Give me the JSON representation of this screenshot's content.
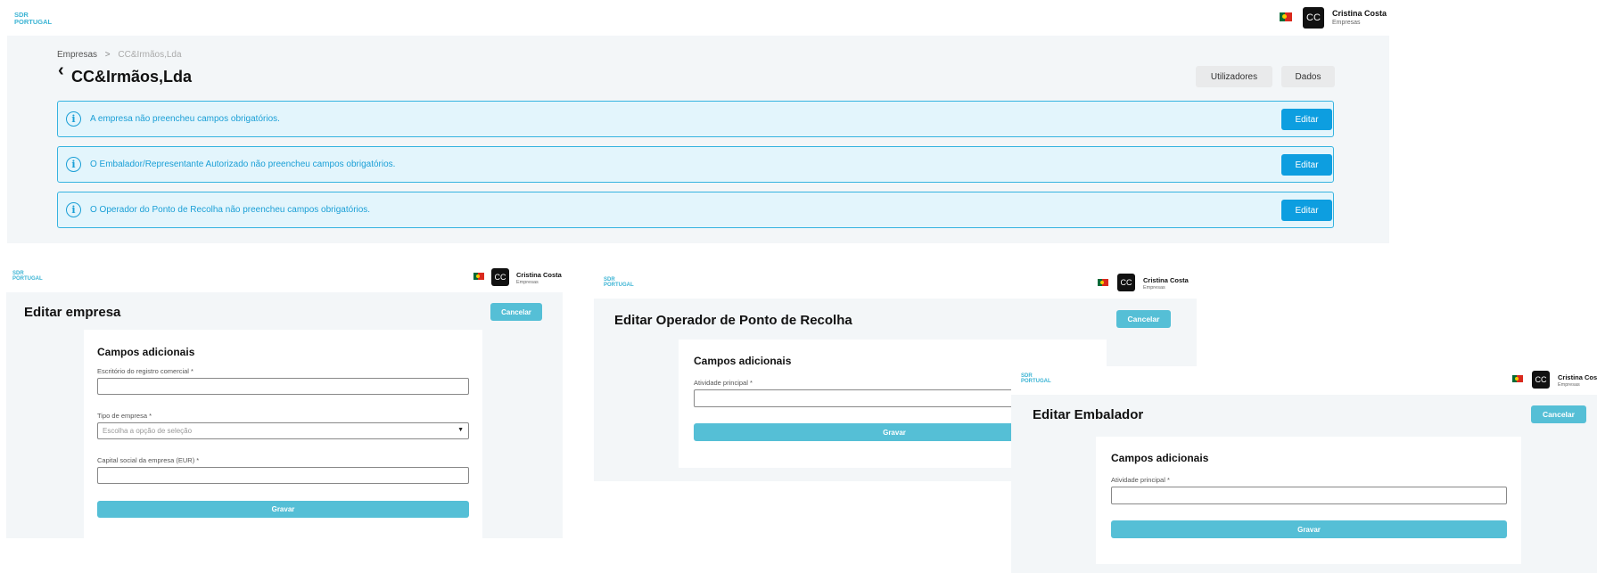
{
  "brand": {
    "line1": "SDR",
    "line2": "PORTUGAL",
    "color": "#3cb4d4"
  },
  "user": {
    "initials": "CC",
    "name": "Cristina Costa",
    "role": "Empresas"
  },
  "company_view": {
    "breadcrumb": {
      "root": "Empresas",
      "separator": ">",
      "current": "CC&Irmãos,Lda"
    },
    "back_icon": "‹",
    "title": "CC&Irmãos,Lda",
    "buttons": {
      "users": "Utilizadores",
      "data": "Dados"
    },
    "alerts": [
      {
        "icon": "i",
        "message": "A empresa não preencheu campos obrigatórios.",
        "action": "Editar"
      },
      {
        "icon": "i",
        "message": "O Embalador/Representante Autorizado não preencheu campos obrigatórios.",
        "action": "Editar"
      },
      {
        "icon": "i",
        "message": "O Operador do Ponto de Recolha não preencheu campos obrigatórios.",
        "action": "Editar"
      }
    ]
  },
  "edit_company": {
    "title": "Editar empresa",
    "cancel": "Cancelar",
    "section": "Campos adicionais",
    "fields": [
      {
        "label": "Escritório do registro comercial *",
        "value": ""
      },
      {
        "label": "Tipo de empresa *",
        "placeholder": "Escolha a opção de seleção",
        "caret": "▼"
      },
      {
        "label": "Capital social da empresa (EUR) *",
        "value": ""
      }
    ],
    "save": "Gravar"
  },
  "edit_operator": {
    "title": "Editar Operador de Ponto de Recolha",
    "cancel": "Cancelar",
    "section": "Campos adicionais",
    "field_label": "Atividade principal *",
    "save": "Gravar"
  },
  "edit_packer": {
    "title": "Editar Embalador",
    "cancel": "Cancelar",
    "section": "Campos adicionais",
    "field_label": "Atividade principal *",
    "save": "Gravar"
  },
  "colors": {
    "accent_blue": "#0d9ee0",
    "teal_button": "#55bfd6",
    "alert_bg": "#e3f5fc",
    "alert_border": "#36b3e0",
    "content_bg": "#f3f6f8"
  }
}
